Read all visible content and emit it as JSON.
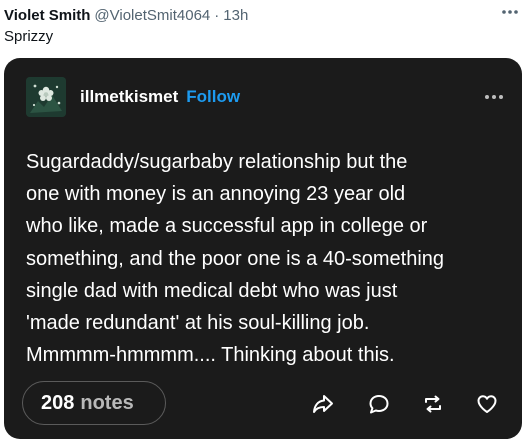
{
  "tweet": {
    "display_name": "Violet Smith",
    "handle": "@VioletSmit4064",
    "separator": "·",
    "time": "13h",
    "text": "Sprizzy",
    "more_icon": "more-horizontal-icon"
  },
  "embedded_post": {
    "username": "illmetkismet",
    "follow_label": "Follow",
    "avatar_icon": "flower-avatar-icon",
    "more_icon": "more-horizontal-icon",
    "body_lines": [
      "Sugardaddy/sugarbaby relationship but the",
      "one with money is an annoying 23 year old",
      "who like, made a successful app in college or",
      "something, and the poor one is a 40-something",
      "single dad with medical debt who was just",
      "'made redundant' at his soul-killing job.",
      "Mmmmm-hmmmm.... Thinking about this."
    ],
    "notes_count": "208",
    "notes_label": "notes",
    "actions": [
      "share-icon",
      "reply-icon",
      "reblog-icon",
      "like-icon"
    ]
  },
  "colors": {
    "card_background": "#1b1b1b",
    "follow": "#1d9bf0",
    "post_text": "#ffffff"
  }
}
